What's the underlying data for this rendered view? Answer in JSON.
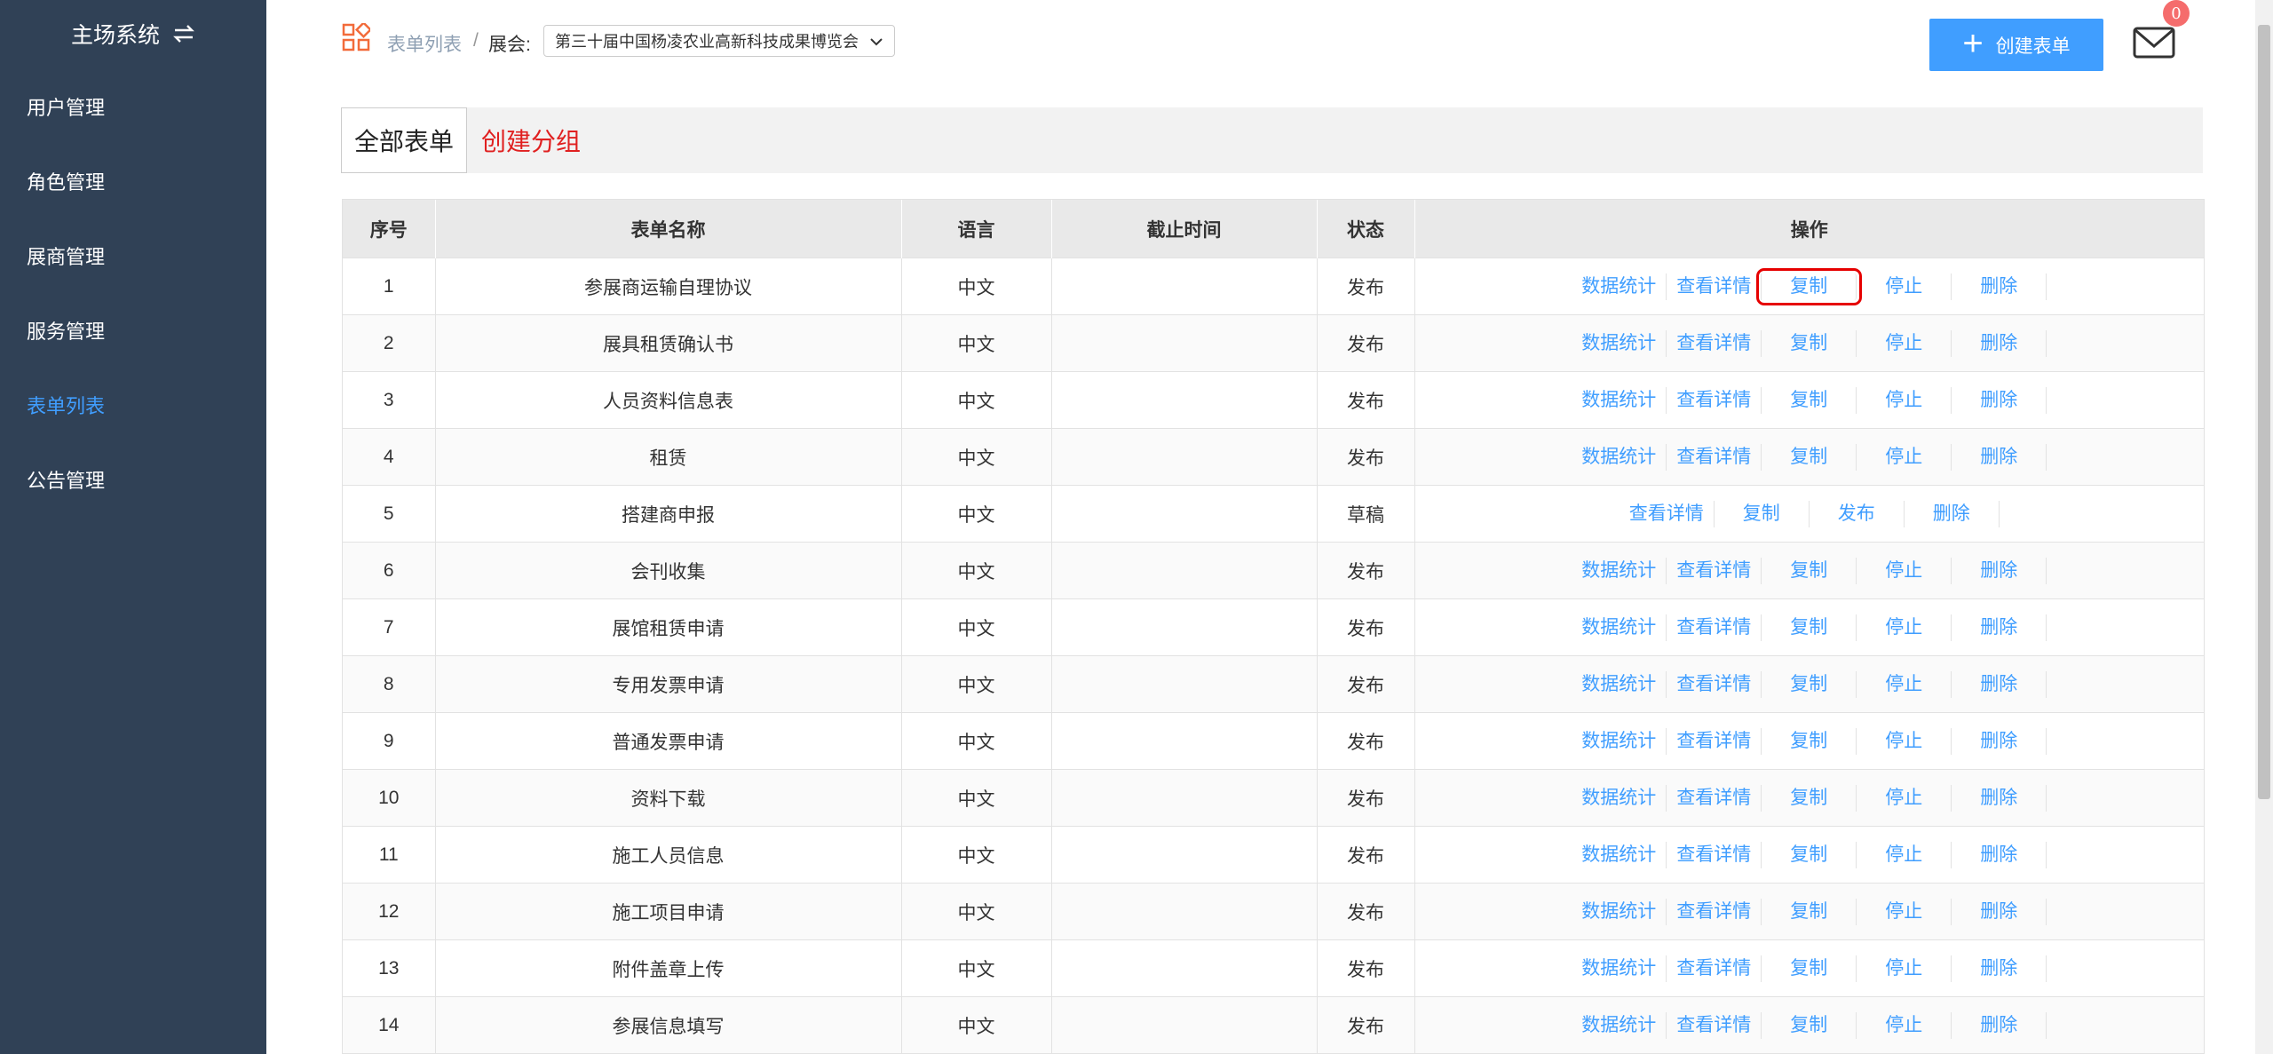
{
  "sidebar": {
    "title": "主场系统",
    "items": [
      {
        "label": "用户管理",
        "active": false
      },
      {
        "label": "角色管理",
        "active": false
      },
      {
        "label": "展商管理",
        "active": false
      },
      {
        "label": "服务管理",
        "active": false
      },
      {
        "label": "表单列表",
        "active": true
      },
      {
        "label": "公告管理",
        "active": false
      }
    ]
  },
  "header": {
    "breadcrumb_link": "表单列表",
    "breadcrumb_sep": "/",
    "fair_label": "展会:",
    "fair_selected": "第三十届中国杨凌农业高新科技成果博览会",
    "create_label": "创建表单",
    "mail_badge": "0"
  },
  "groups": {
    "all_label": "全部表单",
    "create_label": "创建分组"
  },
  "table": {
    "columns": [
      "序号",
      "表单名称",
      "语言",
      "截止时间",
      "状态",
      "操作"
    ],
    "rows": [
      {
        "no": "1",
        "name": "参展商运输自理协议",
        "lang": "中文",
        "deadline": "",
        "status": "发布"
      },
      {
        "no": "2",
        "name": "展具租赁确认书",
        "lang": "中文",
        "deadline": "",
        "status": "发布"
      },
      {
        "no": "3",
        "name": "人员资料信息表",
        "lang": "中文",
        "deadline": "",
        "status": "发布"
      },
      {
        "no": "4",
        "name": "租赁",
        "lang": "中文",
        "deadline": "",
        "status": "发布"
      },
      {
        "no": "5",
        "name": "搭建商申报",
        "lang": "中文",
        "deadline": "",
        "status": "草稿"
      },
      {
        "no": "6",
        "name": "会刊收集",
        "lang": "中文",
        "deadline": "",
        "status": "发布"
      },
      {
        "no": "7",
        "name": "展馆租赁申请",
        "lang": "中文",
        "deadline": "",
        "status": "发布"
      },
      {
        "no": "8",
        "name": "专用发票申请",
        "lang": "中文",
        "deadline": "",
        "status": "发布"
      },
      {
        "no": "9",
        "name": "普通发票申请",
        "lang": "中文",
        "deadline": "",
        "status": "发布"
      },
      {
        "no": "10",
        "name": "资料下载",
        "lang": "中文",
        "deadline": "",
        "status": "发布"
      },
      {
        "no": "11",
        "name": "施工人员信息",
        "lang": "中文",
        "deadline": "",
        "status": "发布"
      },
      {
        "no": "12",
        "name": "施工项目申请",
        "lang": "中文",
        "deadline": "",
        "status": "发布"
      },
      {
        "no": "13",
        "name": "附件盖章上传",
        "lang": "中文",
        "deadline": "",
        "status": "发布"
      },
      {
        "no": "14",
        "name": "参展信息填写",
        "lang": "中文",
        "deadline": "",
        "status": "发布"
      }
    ],
    "ops_published": [
      "数据统计",
      "查看详情",
      "复制",
      "停止",
      "删除"
    ],
    "ops_draft": [
      "查看详情",
      "复制",
      "发布",
      "删除"
    ],
    "highlighted": {
      "row": 0,
      "op": "复制"
    }
  },
  "colors": {
    "sidebar_bg": "#304156",
    "accent": "#409eff",
    "danger": "#e02020"
  }
}
